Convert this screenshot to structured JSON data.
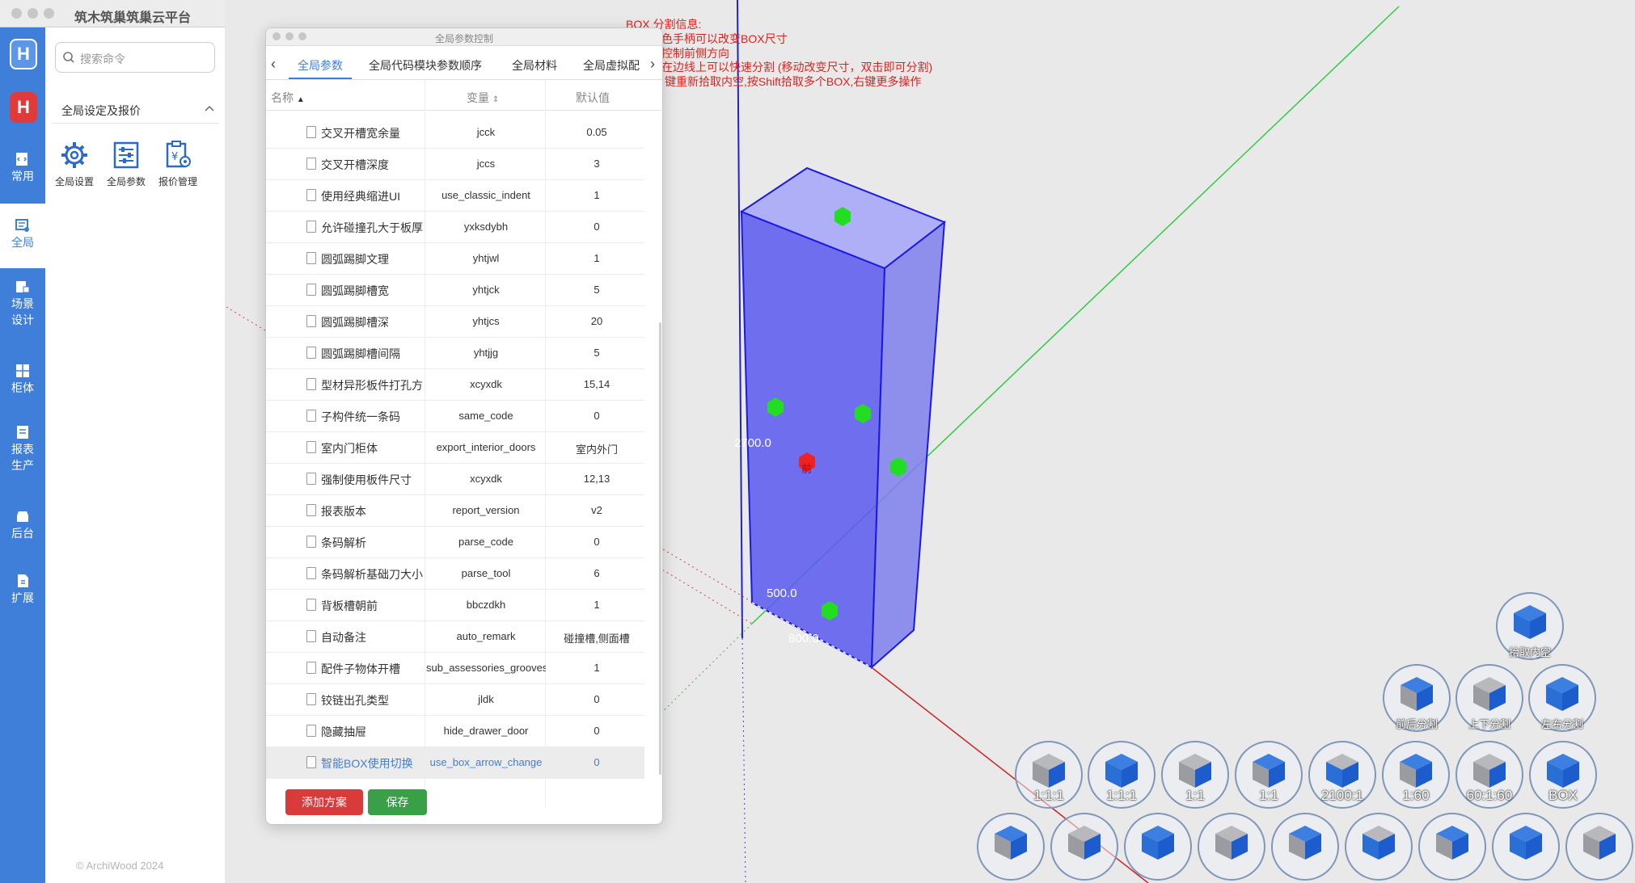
{
  "app": {
    "title": "筑木筑巢筑巢云平台",
    "logo_text": "H",
    "search_placeholder": "搜索命令",
    "rail": [
      {
        "label": "常用"
      },
      {
        "label": "全局"
      },
      {
        "label": "场景设计"
      },
      {
        "label": "柜体"
      },
      {
        "label": "报表生产"
      },
      {
        "label": "后台"
      },
      {
        "label": "扩展"
      }
    ],
    "panel_title": "全局设定及报价",
    "tools": [
      {
        "label": "全局设置",
        "icon": "gear-icon"
      },
      {
        "label": "全局参数",
        "icon": "sliders-icon"
      },
      {
        "label": "报价管理",
        "icon": "quote-icon"
      }
    ],
    "copyright": "© ArchiWood 2024"
  },
  "dialog": {
    "title": "全局参数控制",
    "tabs": [
      "全局参数",
      "全局代码模块参数顺序",
      "全局材料",
      "全局虚拟配"
    ],
    "active_tab": "全局参数",
    "columns": {
      "name": "名称",
      "variable": "变量",
      "default": "默认值"
    },
    "rows": [
      {
        "name": "交叉开槽宽余量",
        "var": "jcck",
        "val": "0.05"
      },
      {
        "name": "交叉开槽深度",
        "var": "jccs",
        "val": "3"
      },
      {
        "name": "使用经典缩进UI",
        "var": "use_classic_indent",
        "val": "1"
      },
      {
        "name": "允许碰撞孔大于板厚",
        "var": "yxksdybh",
        "val": "0"
      },
      {
        "name": "圆弧踢脚文理",
        "var": "yhtjwl",
        "val": "1"
      },
      {
        "name": "圆弧踢脚槽宽",
        "var": "yhtjck",
        "val": "5"
      },
      {
        "name": "圆弧踢脚槽深",
        "var": "yhtjcs",
        "val": "20"
      },
      {
        "name": "圆弧踢脚槽间隔",
        "var": "yhtjjg",
        "val": "5"
      },
      {
        "name": "型材异形板件打孔方",
        "var": "xcyxdk",
        "val": "15,14"
      },
      {
        "name": "子构件统一条码",
        "var": "same_code",
        "val": "0"
      },
      {
        "name": "室内门柜体",
        "var": "export_interior_doors",
        "val": "室内外门"
      },
      {
        "name": "强制使用板件尺寸",
        "var": "xcyxdk",
        "val": "12,13"
      },
      {
        "name": "报表版本",
        "var": "report_version",
        "val": "v2"
      },
      {
        "name": "条码解析",
        "var": "parse_code",
        "val": "0"
      },
      {
        "name": "条码解析基础刀大小",
        "var": "parse_tool",
        "val": "6"
      },
      {
        "name": "背板槽朝前",
        "var": "bbczdkh",
        "val": "1"
      },
      {
        "name": "自动备注",
        "var": "auto_remark",
        "val": "碰撞槽,侧面槽"
      },
      {
        "name": "配件子物体开槽",
        "var": "sub_assessories_grooves",
        "val": "1"
      },
      {
        "name": "铰链出孔类型",
        "var": "jldk",
        "val": "0"
      },
      {
        "name": "隐藏抽屉",
        "var": "hide_drawer_door",
        "val": "0"
      },
      {
        "name": "智能BOX使用切换",
        "var": "use_box_arrow_change",
        "val": "0",
        "selected": true
      }
    ],
    "buttons": {
      "add": "添加方案",
      "save": "保存"
    }
  },
  "viewport": {
    "info_lines": [
      "BOX 分割信息:",
      "色手柄可以改变BOX尺寸",
      "控制前侧方向",
      "在边线上可以快速分割 (移动改变尺寸，双击即可分割)",
      "键重新拾取内空,按Shift拾取多个BOX,右键更多操作"
    ],
    "dim_height": "2700.0",
    "dim_depth": "500.0",
    "dim_width": "800.0",
    "front_marker": "前",
    "palette": {
      "pick": "拾取内空",
      "row1": [
        "前后分割",
        "上下分割",
        "左右分割"
      ],
      "row2": [
        "1:1:1",
        "1:1:1",
        "1:1",
        "1:1",
        "2100:1",
        "1:60",
        "60:1:60",
        "BOX"
      ]
    },
    "colors": {
      "box": "#5a5af0",
      "handle": "#22dd22",
      "front_handle": "#ee2222",
      "info": "#e0201c",
      "accent": "#3f7fd9"
    }
  }
}
